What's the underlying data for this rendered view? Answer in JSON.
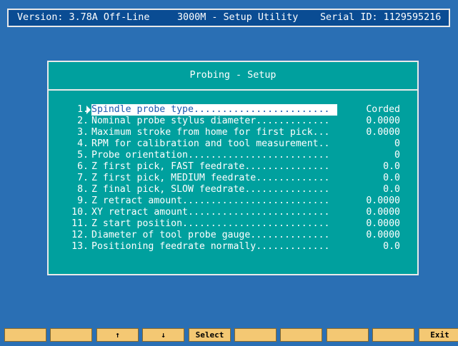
{
  "header": {
    "version": "Version: 3.78A Off-Line",
    "title": "3000M - Setup Utility",
    "serial": "Serial ID: 1129595216"
  },
  "dialog": {
    "title": "Probing - Setup",
    "selected_index": 0,
    "items": [
      {
        "num": "1.",
        "label": "Spindle probe type........................",
        "value": "Corded"
      },
      {
        "num": "2.",
        "label": "Nominal probe stylus diameter.............",
        "value": "0.0000"
      },
      {
        "num": "3.",
        "label": "Maximum stroke from home for first pick...",
        "value": "0.0000"
      },
      {
        "num": "4.",
        "label": "RPM for calibration and tool measurement..",
        "value": "0"
      },
      {
        "num": "5.",
        "label": "Probe orientation.........................",
        "value": "0"
      },
      {
        "num": "6.",
        "label": "Z first pick, FAST feedrate...............",
        "value": "0.0"
      },
      {
        "num": "7.",
        "label": "Z first pick, MEDIUM feedrate.............",
        "value": "0.0"
      },
      {
        "num": "8.",
        "label": "Z final pick, SLOW feedrate...............",
        "value": "0.0"
      },
      {
        "num": "9.",
        "label": "Z retract amount..........................",
        "value": "0.0000"
      },
      {
        "num": "10.",
        "label": "XY retract amount.........................",
        "value": "0.0000"
      },
      {
        "num": "11.",
        "label": "Z start position..........................",
        "value": "0.0000"
      },
      {
        "num": "12.",
        "label": "Diameter of tool probe gauge..............",
        "value": "0.0000"
      },
      {
        "num": "13.",
        "label": "Positioning feedrate normally.............",
        "value": "0.0"
      }
    ]
  },
  "softkeys": [
    {
      "label": ""
    },
    {
      "label": ""
    },
    {
      "label": "↑"
    },
    {
      "label": "↓"
    },
    {
      "label": "Select"
    },
    {
      "label": ""
    },
    {
      "label": ""
    },
    {
      "label": ""
    },
    {
      "label": ""
    },
    {
      "label": "Exit"
    }
  ],
  "colors": {
    "background": "#2a6fb4",
    "header_bg": "#0a4c93",
    "dialog_bg": "#00a09e",
    "highlight_text": "#1a58b0",
    "softkey_bg": "#f4c873"
  }
}
